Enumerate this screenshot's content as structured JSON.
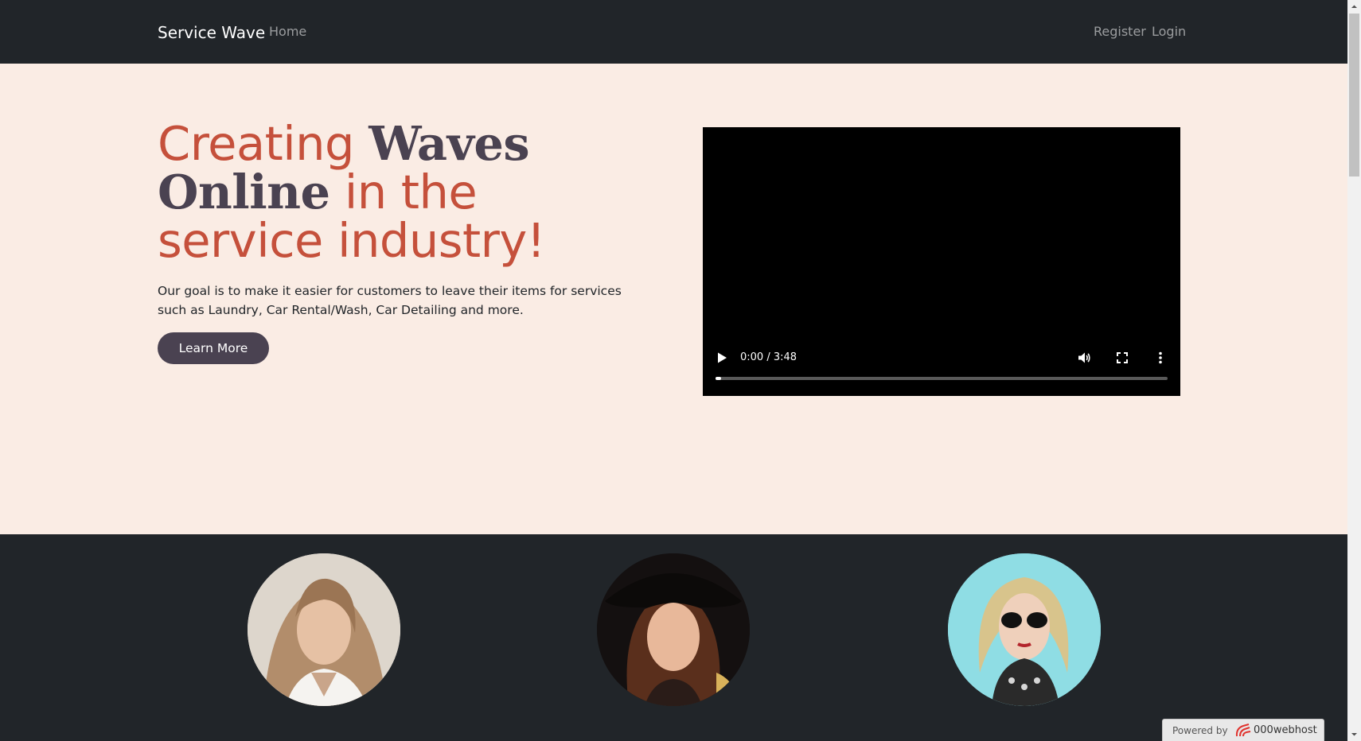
{
  "navbar": {
    "brand": "Service Wave",
    "home": "Home",
    "register": "Register",
    "login": "Login"
  },
  "hero": {
    "headline": {
      "creating": "Creating ",
      "waves": "Waves",
      "online": "Online",
      "rest": " in the service industry!"
    },
    "text": "Our goal is to make it easier for customers to leave their items for services such as Laundry, Car Rental/Wash, Car Detailing and more.",
    "button": "Learn More"
  },
  "video": {
    "time": "0:00 / 3:48",
    "progress_fraction": 0.012
  },
  "team": {
    "avatars": [
      "portrait-photo",
      "portrait-photo",
      "portrait-photo"
    ]
  },
  "badge": {
    "powered": "Powered by",
    "brand": "000webhost"
  },
  "colors": {
    "navbar_bg": "#212529",
    "hero_bg": "#faece4",
    "accent": "#c5503b",
    "headline_dark": "#4a4251",
    "button_bg": "#4a4251"
  },
  "icons": [
    "play-icon",
    "volume-icon",
    "fullscreen-icon",
    "more-options-icon",
    "000webhost-logo-icon",
    "scroll-up-icon",
    "scroll-down-icon"
  ]
}
